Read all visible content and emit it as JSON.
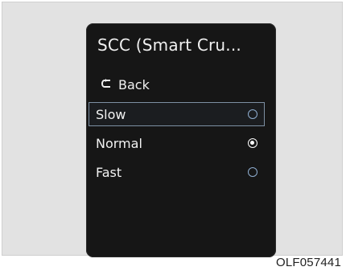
{
  "screen": {
    "title": "SCC (Smart Cru...",
    "back_label": "Back",
    "options": [
      {
        "label": "Slow",
        "checked": false,
        "highlighted": true
      },
      {
        "label": "Normal",
        "checked": true,
        "highlighted": false
      },
      {
        "label": "Fast",
        "checked": false,
        "highlighted": false
      }
    ]
  },
  "caption": "OLF057441",
  "colors": {
    "screen_bg": "#161616",
    "highlight_border": "#7d90a3",
    "radio_border": "#8faed0",
    "text": "#f0f0f0"
  }
}
